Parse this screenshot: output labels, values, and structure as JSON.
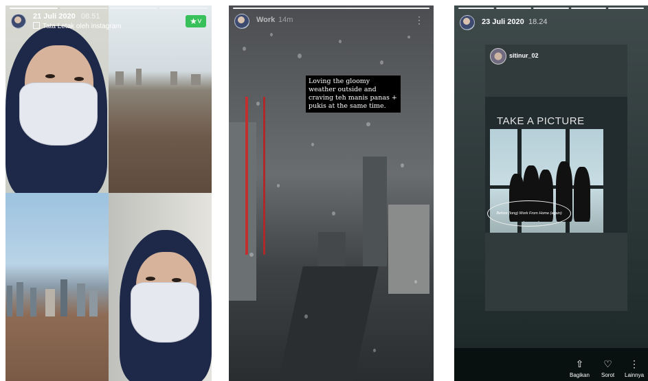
{
  "story1": {
    "date": "21 Juli 2020",
    "time": "08.51",
    "layout_label": "Tata Letak oleh instagram",
    "sticker_glyph": "★˅",
    "progress_segments": 4,
    "progress_done": 1
  },
  "story2": {
    "title": "Work",
    "time": "14m",
    "caption": "Loving the gloomy weather outside and craving teh manis panas + pukis at the same time.",
    "progress_segments": 1,
    "progress_done": 1
  },
  "story3": {
    "date": "23 Juli 2020",
    "time": "18.24",
    "repost_username": "sitinur_02",
    "poster_title": "TAKE A PICTURE",
    "poster_caption": "Before (long) Work From Home (again)",
    "progress_segments": 5,
    "progress_done": 5,
    "actions": [
      {
        "label": "Bagikan",
        "icon": "share-icon",
        "glyph": "⇧"
      },
      {
        "label": "Sorot",
        "icon": "highlight-icon",
        "glyph": "♡"
      },
      {
        "label": "Lainnya",
        "icon": "more-icon",
        "glyph": "⋮"
      }
    ]
  }
}
